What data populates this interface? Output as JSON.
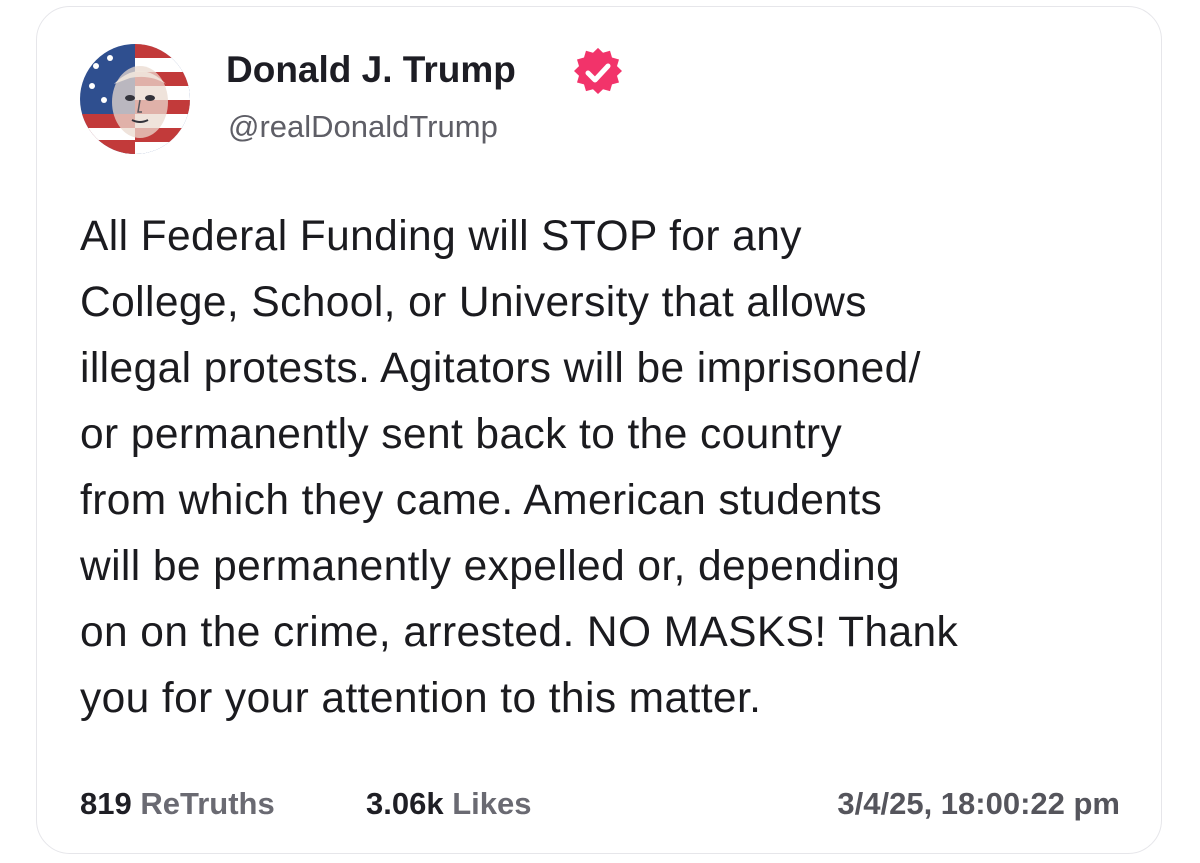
{
  "post": {
    "author": {
      "display_name": "Donald J. Trump",
      "handle": "@realDonaldTrump",
      "verified_icon": "verified-badge-icon",
      "verified_color": "#f2336a",
      "avatar_icon": "avatar-image"
    },
    "body_lines": [
      "All Federal Funding will STOP for any",
      "College, School, or University that allows",
      "illegal protests. Agitators will be imprisoned/",
      "or permanently sent back to the country",
      "from which they came. American students",
      "will be permanently expelled or, depending",
      "on on the crime, arrested. NO MASKS! Thank",
      "you for your attention to this matter."
    ],
    "stats": {
      "retruths_count": "819",
      "retruths_label": "ReTruths",
      "likes_count": "3.06k",
      "likes_label": "Likes"
    },
    "timestamp": "3/4/25, 18:00:22 pm"
  }
}
